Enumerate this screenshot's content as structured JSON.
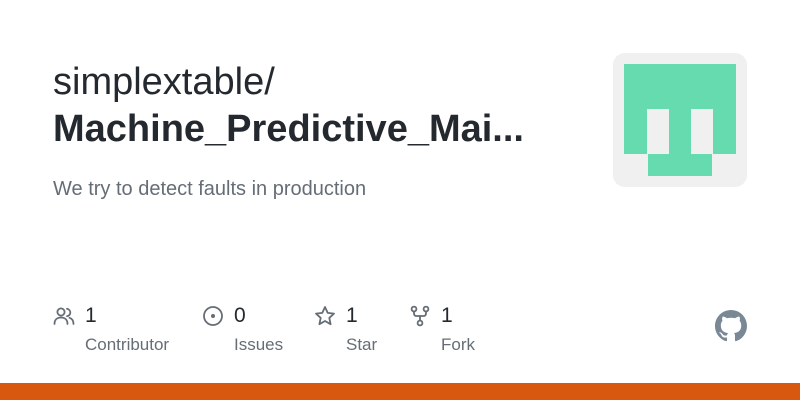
{
  "header": {
    "owner": "simplextable/",
    "repo": "Machine_Predictive_Mai..."
  },
  "description": "We try to detect faults in production",
  "avatar": {
    "icon": "identicon-avatar",
    "color": "#66dbaf",
    "background": "#f0f0f0"
  },
  "stats": {
    "contributors": {
      "value": "1",
      "label": "Contributor",
      "icon": "people-icon"
    },
    "issues": {
      "value": "0",
      "label": "Issues",
      "icon": "issue-opened-icon"
    },
    "stars": {
      "value": "1",
      "label": "Star",
      "icon": "star-icon"
    },
    "forks": {
      "value": "1",
      "label": "Fork",
      "icon": "repo-forked-icon"
    }
  },
  "logo": {
    "icon": "github-mark-icon",
    "color": "#7a8895"
  },
  "colors": {
    "title": "#24292f",
    "muted": "#656d76",
    "language_bar": "#d9580f"
  }
}
